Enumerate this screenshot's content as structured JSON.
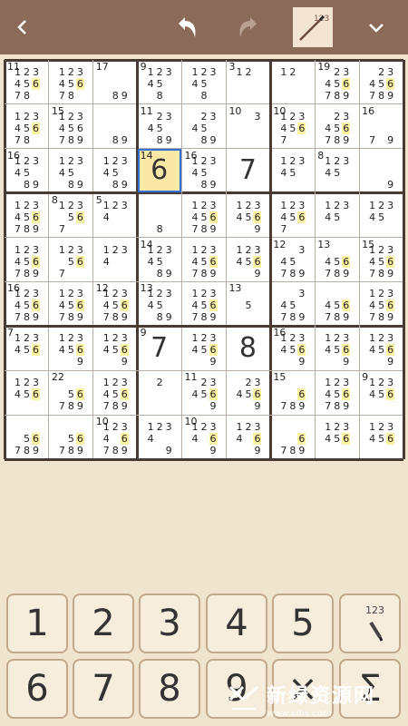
{
  "toolbar": {
    "back_icon": "chevron-left-icon",
    "undo_icon": "undo-arrow-icon",
    "redo_icon": "redo-arrow-icon",
    "pencil_icon": "pencil-notes-icon",
    "pencil_label": "123",
    "menu_icon": "chevron-down-icon"
  },
  "board": {
    "cells": [
      [
        {
          "cage": "11",
          "cand": [
            1,
            2,
            3,
            4,
            5,
            6,
            7,
            8
          ],
          "hl": [
            6
          ]
        },
        {
          "cage": "",
          "cand": [
            1,
            2,
            3,
            4,
            5,
            6,
            7,
            8
          ],
          "hl": [
            6
          ]
        },
        {
          "cage": "17",
          "cand": [
            8,
            9
          ]
        },
        {
          "cage": "9",
          "cand": [
            1,
            2,
            3,
            4,
            5,
            8
          ]
        },
        {
          "cage": "",
          "cand": [
            1,
            2,
            3,
            4,
            5,
            8
          ]
        },
        {
          "cage": "3",
          "cand": [
            1,
            2
          ]
        },
        {
          "cage": "",
          "cand": [
            1,
            2
          ]
        },
        {
          "cage": "19",
          "cand": [
            2,
            3,
            4,
            5,
            6,
            7,
            8,
            9
          ],
          "hl": [
            6
          ]
        },
        {
          "cage": "",
          "cand": [
            2,
            3,
            4,
            5,
            6,
            7,
            8,
            9
          ],
          "hl": [
            6
          ]
        }
      ],
      [
        {
          "cage": "",
          "cand": [
            1,
            2,
            3,
            4,
            5,
            6,
            7,
            8
          ],
          "hl": [
            6
          ]
        },
        {
          "cage": "15",
          "cand": [
            1,
            2,
            3,
            4,
            5,
            6,
            7,
            8,
            9
          ]
        },
        {
          "cage": "",
          "cand": [
            8,
            9
          ]
        },
        {
          "cage": "11",
          "cand": [
            2,
            3,
            4,
            5,
            8,
            9
          ]
        },
        {
          "cage": "",
          "cand": [
            2,
            3,
            4,
            5,
            8,
            9
          ]
        },
        {
          "cage": "10",
          "cand": [
            3
          ]
        },
        {
          "cage": "10",
          "cand": [
            1,
            2,
            3,
            4,
            5,
            6,
            7
          ],
          "hl": [
            6
          ]
        },
        {
          "cage": "",
          "cand": [
            2,
            3,
            4,
            5,
            6,
            7,
            8,
            9
          ],
          "hl": [
            6
          ]
        },
        {
          "cage": "16",
          "cand": [
            7,
            9
          ]
        }
      ],
      [
        {
          "cage": "16",
          "cand": [
            1,
            2,
            3,
            4,
            5,
            8,
            9
          ]
        },
        {
          "cage": "",
          "cand": [
            1,
            2,
            3,
            4,
            5,
            8,
            9
          ]
        },
        {
          "cage": "",
          "cand": [
            1,
            2,
            3,
            4,
            5,
            8,
            9
          ]
        },
        {
          "cage": "14",
          "val": "6",
          "sel": true
        },
        {
          "cage": "16",
          "cand": [
            1,
            2,
            3,
            4,
            5,
            8,
            9
          ]
        },
        {
          "cage": "",
          "val": "7"
        },
        {
          "cage": "",
          "cand": [
            1,
            2,
            3,
            4,
            5
          ]
        },
        {
          "cage": "8",
          "cand": [
            1,
            2,
            3,
            4,
            5
          ]
        },
        {
          "cage": "",
          "cand": [
            9
          ]
        }
      ],
      [
        {
          "cage": "",
          "cand": [
            1,
            2,
            3,
            4,
            5,
            6,
            7,
            8,
            9
          ],
          "hl": [
            6
          ]
        },
        {
          "cage": "8",
          "cand": [
            1,
            2,
            3,
            5,
            6,
            7
          ],
          "hl": [
            6
          ]
        },
        {
          "cage": "5",
          "cand": [
            1,
            2,
            3,
            4
          ]
        },
        {
          "cage": "",
          "cand": [
            8
          ]
        },
        {
          "cage": "",
          "cand": [
            1,
            2,
            3,
            4,
            5,
            6,
            7,
            8,
            9
          ],
          "hl": [
            6
          ]
        },
        {
          "cage": "",
          "cand": [
            1,
            2,
            3,
            4,
            5,
            6,
            9
          ],
          "hl": [
            6
          ]
        },
        {
          "cage": "",
          "cand": [
            1,
            2,
            3,
            4,
            5,
            6,
            7
          ],
          "hl": [
            6
          ]
        },
        {
          "cage": "",
          "cand": [
            1,
            2,
            3,
            4,
            5
          ]
        },
        {
          "cage": "",
          "cand": [
            1,
            2,
            3,
            4,
            5
          ]
        }
      ],
      [
        {
          "cage": "",
          "cand": [
            1,
            2,
            3,
            4,
            5,
            6,
            7,
            8,
            9
          ],
          "hl": [
            6
          ]
        },
        {
          "cage": "",
          "cand": [
            1,
            2,
            3,
            5,
            6,
            7
          ],
          "hl": [
            6
          ]
        },
        {
          "cage": "",
          "cand": [
            1,
            2,
            3,
            4
          ]
        },
        {
          "cage": "14",
          "cand": [
            1,
            2,
            3,
            4,
            5,
            8,
            9
          ]
        },
        {
          "cage": "",
          "cand": [
            1,
            2,
            3,
            4,
            5,
            6,
            7,
            8,
            9
          ],
          "hl": [
            6
          ]
        },
        {
          "cage": "",
          "cand": [
            1,
            2,
            3,
            4,
            5,
            6,
            9
          ],
          "hl": [
            6
          ]
        },
        {
          "cage": "12",
          "cand": [
            3,
            4,
            5,
            7,
            8,
            9
          ]
        },
        {
          "cage": "13",
          "cand": [
            4,
            5,
            6,
            7,
            8,
            9
          ],
          "hl": [
            6
          ]
        },
        {
          "cage": "15",
          "cand": [
            1,
            2,
            3,
            4,
            5,
            6,
            7,
            8,
            9
          ],
          "hl": [
            6
          ]
        }
      ],
      [
        {
          "cage": "16",
          "cand": [
            1,
            2,
            3,
            4,
            5,
            6,
            7,
            8,
            9
          ],
          "hl": [
            6
          ]
        },
        {
          "cage": "",
          "cand": [
            1,
            2,
            3,
            4,
            5,
            6,
            7,
            8,
            9
          ],
          "hl": [
            6
          ]
        },
        {
          "cage": "12",
          "cand": [
            1,
            2,
            3,
            4,
            5,
            6,
            7,
            8,
            9
          ],
          "hl": [
            6
          ]
        },
        {
          "cage": "13",
          "cand": [
            1,
            2,
            3,
            4,
            5,
            8,
            9
          ]
        },
        {
          "cage": "",
          "cand": [
            1,
            2,
            3,
            4,
            5,
            6,
            7,
            8,
            9
          ],
          "hl": [
            6
          ]
        },
        {
          "cage": "13",
          "cand": [
            5
          ]
        },
        {
          "cage": "",
          "cand": [
            3,
            4,
            5,
            7,
            8,
            9
          ]
        },
        {
          "cage": "",
          "cand": [
            4,
            5,
            6,
            7,
            8,
            9
          ],
          "hl": [
            6
          ]
        },
        {
          "cage": "",
          "cand": [
            1,
            2,
            3,
            4,
            5,
            6,
            7,
            8,
            9
          ],
          "hl": [
            6
          ]
        }
      ],
      [
        {
          "cage": "7",
          "cand": [
            1,
            2,
            3,
            4,
            5,
            6
          ],
          "hl": [
            6
          ]
        },
        {
          "cage": "",
          "cand": [
            1,
            2,
            3,
            4,
            5,
            6,
            9
          ],
          "hl": [
            6
          ]
        },
        {
          "cage": "",
          "cand": [
            1,
            2,
            3,
            4,
            5,
            6,
            9
          ],
          "hl": [
            6
          ]
        },
        {
          "cage": "9",
          "val": "7"
        },
        {
          "cage": "",
          "cand": [
            1,
            2,
            3,
            4,
            5,
            6,
            9
          ],
          "hl": [
            6
          ]
        },
        {
          "cage": "",
          "val": "8"
        },
        {
          "cage": "16",
          "cand": [
            1,
            2,
            3,
            4,
            5,
            6,
            9
          ],
          "hl": [
            6
          ]
        },
        {
          "cage": "",
          "cand": [
            1,
            2,
            3,
            4,
            5,
            6,
            9
          ],
          "hl": [
            6
          ]
        },
        {
          "cage": "",
          "cand": [
            1,
            2,
            3,
            4,
            5,
            6,
            9
          ],
          "hl": [
            6
          ]
        }
      ],
      [
        {
          "cage": "",
          "cand": [
            1,
            2,
            3,
            4,
            5,
            6
          ],
          "hl": [
            6
          ]
        },
        {
          "cage": "22",
          "cand": [
            5,
            6,
            7,
            8,
            9
          ],
          "hl": [
            6
          ]
        },
        {
          "cage": "",
          "cand": [
            1,
            2,
            3,
            4,
            5,
            6,
            7,
            8,
            9
          ],
          "hl": [
            6
          ]
        },
        {
          "cage": "",
          "cand": [
            2
          ]
        },
        {
          "cage": "11",
          "cand": [
            2,
            3,
            4,
            5,
            6,
            9
          ],
          "hl": [
            6
          ]
        },
        {
          "cage": "",
          "cand": [
            2,
            3,
            4,
            5,
            6,
            9
          ],
          "hl": [
            6
          ]
        },
        {
          "cage": "15",
          "cand": [
            6,
            7,
            8,
            9
          ],
          "hl": [
            6
          ]
        },
        {
          "cage": "",
          "cand": [
            1,
            2,
            3,
            4,
            5,
            6,
            7,
            8,
            9
          ],
          "hl": [
            6
          ]
        },
        {
          "cage": "9",
          "cand": [
            1,
            2,
            3,
            4,
            5,
            6
          ],
          "hl": [
            6
          ]
        }
      ],
      [
        {
          "cage": "",
          "cand": [
            5,
            6,
            7,
            8,
            9
          ],
          "hl": [
            6
          ]
        },
        {
          "cage": "",
          "cand": [
            5,
            6,
            7,
            8,
            9
          ],
          "hl": [
            6
          ]
        },
        {
          "cage": "10",
          "cand": [
            1,
            2,
            3,
            4,
            6,
            7,
            8,
            9
          ],
          "hl": [
            6
          ]
        },
        {
          "cage": "",
          "cand": [
            1,
            2,
            3,
            4,
            9
          ]
        },
        {
          "cage": "10",
          "cand": [
            1,
            2,
            3,
            4,
            6,
            9
          ],
          "hl": [
            6
          ]
        },
        {
          "cage": "",
          "cand": [
            1,
            2,
            3,
            4,
            6,
            9
          ],
          "hl": [
            6
          ]
        },
        {
          "cage": "",
          "cand": [
            6,
            7,
            8,
            9
          ],
          "hl": [
            6
          ]
        },
        {
          "cage": "",
          "cand": [
            1,
            2,
            3,
            4,
            5,
            6
          ],
          "hl": [
            6
          ]
        },
        {
          "cage": "",
          "cand": [
            1,
            2,
            3,
            4,
            5,
            6
          ],
          "hl": [
            6
          ]
        }
      ]
    ]
  },
  "keypad": {
    "keys": [
      "1",
      "2",
      "3",
      "4",
      "5",
      "pencil",
      "6",
      "7",
      "8",
      "9",
      "×",
      "Σ"
    ],
    "pencil_label": "123"
  },
  "watermark": {
    "text": "新绿资源网",
    "url": "www.xlhs.com"
  }
}
